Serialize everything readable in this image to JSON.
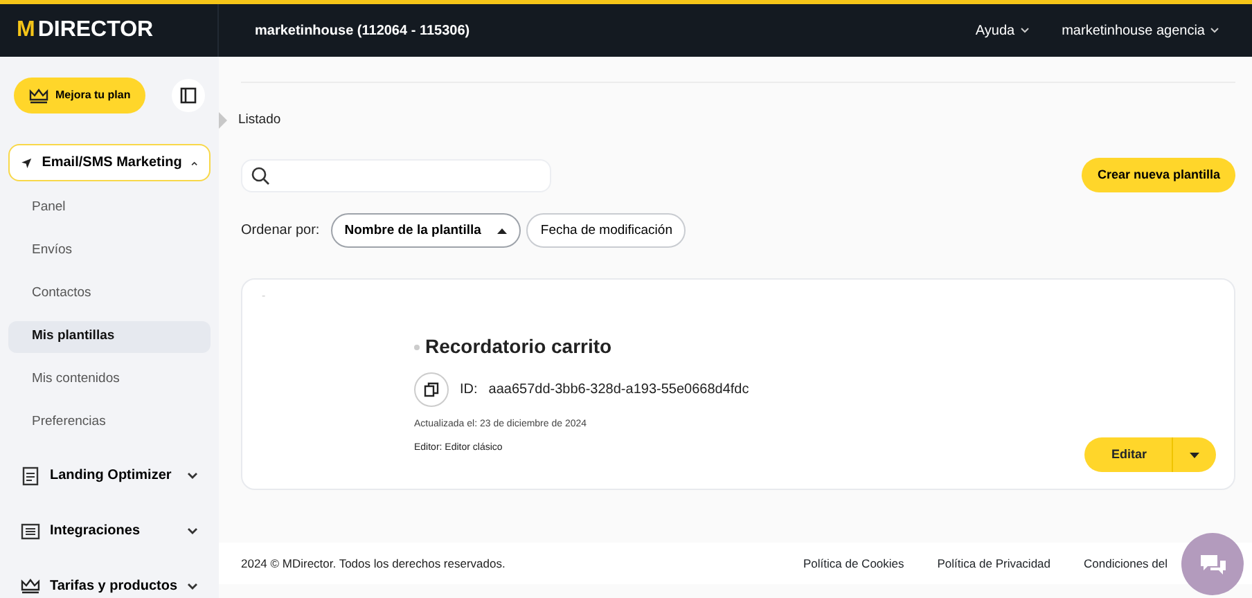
{
  "header": {
    "logo_mark": "M",
    "logo_text": "DIRECTOR",
    "account": "marketinhouse (112064 - 115306)",
    "menus": [
      "Ayuda",
      "marketinhouse agencia"
    ]
  },
  "sidebar": {
    "upgrade_button": "Mejora tu plan",
    "sections": [
      {
        "label": "Email/SMS Marketing",
        "kind": "send",
        "expanded": true,
        "children": [
          {
            "label": "Panel",
            "selected": false
          },
          {
            "label": "Envíos",
            "selected": false
          },
          {
            "label": "Contactos",
            "selected": false
          },
          {
            "label": "Mis plantillas",
            "selected": true
          },
          {
            "label": "Mis contenidos",
            "selected": false
          },
          {
            "label": "Preferencias",
            "selected": false
          }
        ]
      },
      {
        "label": "Landing Optimizer",
        "kind": "page",
        "expanded": false
      },
      {
        "label": "Integraciones",
        "kind": "list",
        "expanded": false
      },
      {
        "label": "Tarifas y productos",
        "kind": "crown",
        "expanded": false
      }
    ]
  },
  "breadcrumb": "Listado",
  "create_button": "Crear nueva plantilla",
  "sort": {
    "label": "Ordenar por:",
    "options": [
      {
        "label": "Nombre de la plantilla",
        "selected": true
      },
      {
        "label": "Fecha de modificación",
        "selected": false
      }
    ]
  },
  "template": {
    "corner_mark": "-",
    "title": "Recordatorio carrito",
    "id_label": "ID:",
    "id": "aaa657dd-3bb6-328d-a193-55e0668d4fdc",
    "updated": "Actualizada el: 23 de diciembre de 2024",
    "editor": "Editor: Editor clásico",
    "edit_button": "Editar"
  },
  "footer": {
    "copyright": "2024 © MDirector. Todos los derechos reservados.",
    "links": [
      "Política de Cookies",
      "Política de Privacidad",
      "Condiciones del"
    ]
  }
}
